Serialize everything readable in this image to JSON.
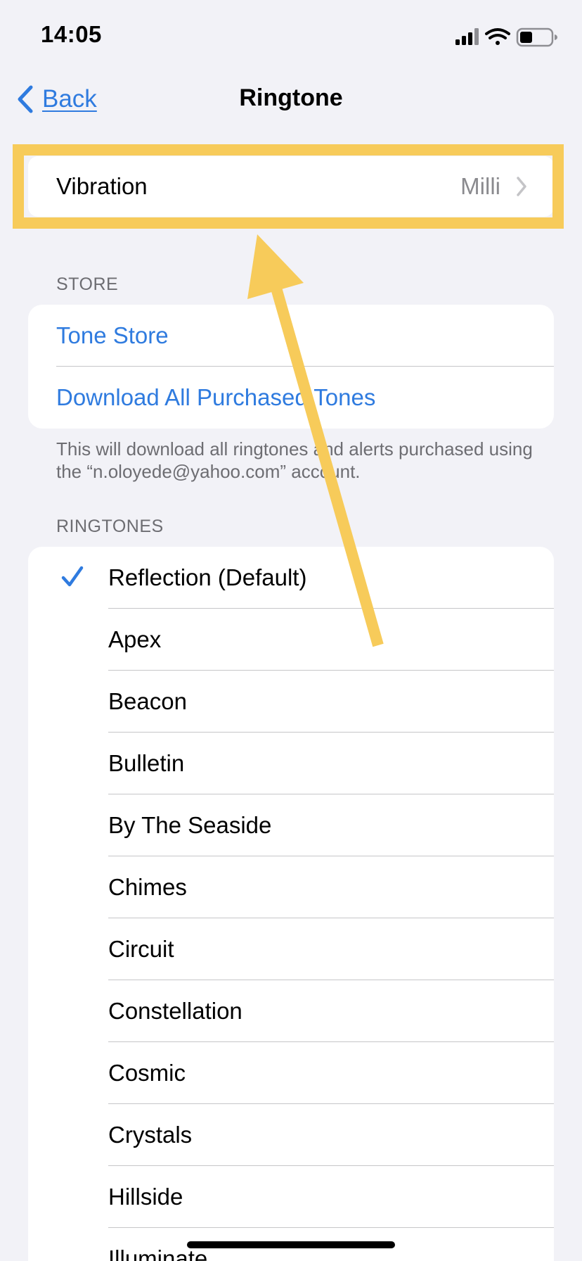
{
  "status_bar": {
    "time": "14:05"
  },
  "nav": {
    "back_label": "Back",
    "title": "Ringtone"
  },
  "vibration": {
    "label": "Vibration",
    "value": "Milli"
  },
  "store_section": {
    "header": "STORE",
    "items": [
      {
        "label": "Tone Store"
      },
      {
        "label": "Download All Purchased Tones"
      }
    ],
    "footer": "This will download all ringtones and alerts purchased using the “n.oloyede@yahoo.com” account."
  },
  "ringtones_section": {
    "header": "RINGTONES",
    "items": [
      {
        "label": "Reflection (Default)",
        "selected": true
      },
      {
        "label": "Apex"
      },
      {
        "label": "Beacon"
      },
      {
        "label": "Bulletin"
      },
      {
        "label": "By The Seaside"
      },
      {
        "label": "Chimes"
      },
      {
        "label": "Circuit"
      },
      {
        "label": "Constellation"
      },
      {
        "label": "Cosmic"
      },
      {
        "label": "Crystals"
      },
      {
        "label": "Hillside"
      },
      {
        "label": "Illuminate"
      }
    ]
  },
  "colors": {
    "accent": "#2f7bdf",
    "highlight": "#f7cb5a",
    "background": "#f2f2f7",
    "secondary_text": "#8a8a8e"
  },
  "icons": {
    "cellular": "cellular-signal-icon",
    "wifi": "wifi-icon",
    "battery": "battery-icon",
    "back": "chevron-left-icon",
    "disclosure": "chevron-right-icon",
    "checkmark": "checkmark-icon"
  }
}
